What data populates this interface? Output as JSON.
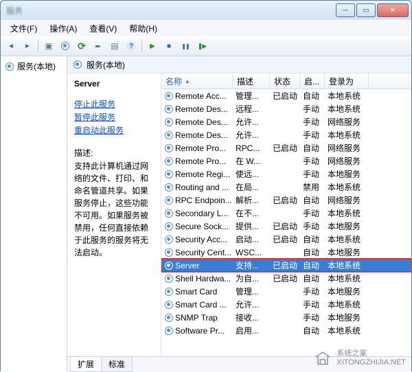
{
  "window": {
    "title": "服务"
  },
  "menu": {
    "file": "文件(F)",
    "action": "操作(A)",
    "view": "查看(V)",
    "help": "帮助(H)"
  },
  "tree": {
    "root": "服务(本地)"
  },
  "main_header": "服务(本地)",
  "details": {
    "title": "Server",
    "stop": "停止此服务",
    "pause": "暂停此服务",
    "restart": "重启动此服务",
    "desc_label": "描述:",
    "desc_text": "支持此计算机通过网络的文件、打印、和命名管道共享。如果服务停止，这些功能不可用。如果服务被禁用，任何直接依赖于此服务的服务将无法启动。"
  },
  "columns": {
    "name": "名称",
    "desc": "描述",
    "status": "状态",
    "start": "启...",
    "logon": "登录为"
  },
  "rows": [
    {
      "name": "Remote Acc...",
      "desc": "管理...",
      "status": "已启动",
      "start": "自动",
      "logon": "本地系统"
    },
    {
      "name": "Remote Des...",
      "desc": "远程...",
      "status": "",
      "start": "手动",
      "logon": "本地系统"
    },
    {
      "name": "Remote Des...",
      "desc": "允许...",
      "status": "",
      "start": "手动",
      "logon": "网络服务"
    },
    {
      "name": "Remote Des...",
      "desc": "允许...",
      "status": "",
      "start": "手动",
      "logon": "本地系统"
    },
    {
      "name": "Remote Pro...",
      "desc": "RPC...",
      "status": "已启动",
      "start": "自动",
      "logon": "网络服务"
    },
    {
      "name": "Remote Pro...",
      "desc": "在 W...",
      "status": "",
      "start": "手动",
      "logon": "网络服务"
    },
    {
      "name": "Remote Regi...",
      "desc": "使远...",
      "status": "",
      "start": "手动",
      "logon": "本地服务"
    },
    {
      "name": "Routing and ...",
      "desc": "在局...",
      "status": "",
      "start": "禁用",
      "logon": "本地系统"
    },
    {
      "name": "RPC Endpoin...",
      "desc": "解析...",
      "status": "已启动",
      "start": "自动",
      "logon": "网络服务"
    },
    {
      "name": "Secondary L...",
      "desc": "在不...",
      "status": "",
      "start": "手动",
      "logon": "本地系统"
    },
    {
      "name": "Secure Sock...",
      "desc": "提供...",
      "status": "已启动",
      "start": "手动",
      "logon": "本地服务"
    },
    {
      "name": "Security Acc...",
      "desc": "启动...",
      "status": "已启动",
      "start": "自动",
      "logon": "本地系统"
    },
    {
      "name": "Security Cent...",
      "desc": "WSC...",
      "status": "",
      "start": "自动",
      "logon": "本地服务"
    },
    {
      "name": "Server",
      "desc": "支持...",
      "status": "已启动",
      "start": "自动",
      "logon": "本地系统",
      "selected": true
    },
    {
      "name": "Shell Hardwa...",
      "desc": "为自...",
      "status": "已启动",
      "start": "自动",
      "logon": "本地系统"
    },
    {
      "name": "Smart Card",
      "desc": "管理...",
      "status": "",
      "start": "手动",
      "logon": "本地服务"
    },
    {
      "name": "Smart Card ...",
      "desc": "允许...",
      "status": "",
      "start": "手动",
      "logon": "本地系统"
    },
    {
      "name": "SNMP Trap",
      "desc": "接收...",
      "status": "",
      "start": "手动",
      "logon": "本地服务"
    },
    {
      "name": "Software Pr...",
      "desc": "启用...",
      "status": "",
      "start": "自动",
      "logon": "本地系统"
    }
  ],
  "tabs": {
    "extended": "扩展",
    "standard": "标准"
  },
  "watermark": {
    "line1": "系统之家",
    "line2": "XITONGZHIJIA.NET"
  }
}
